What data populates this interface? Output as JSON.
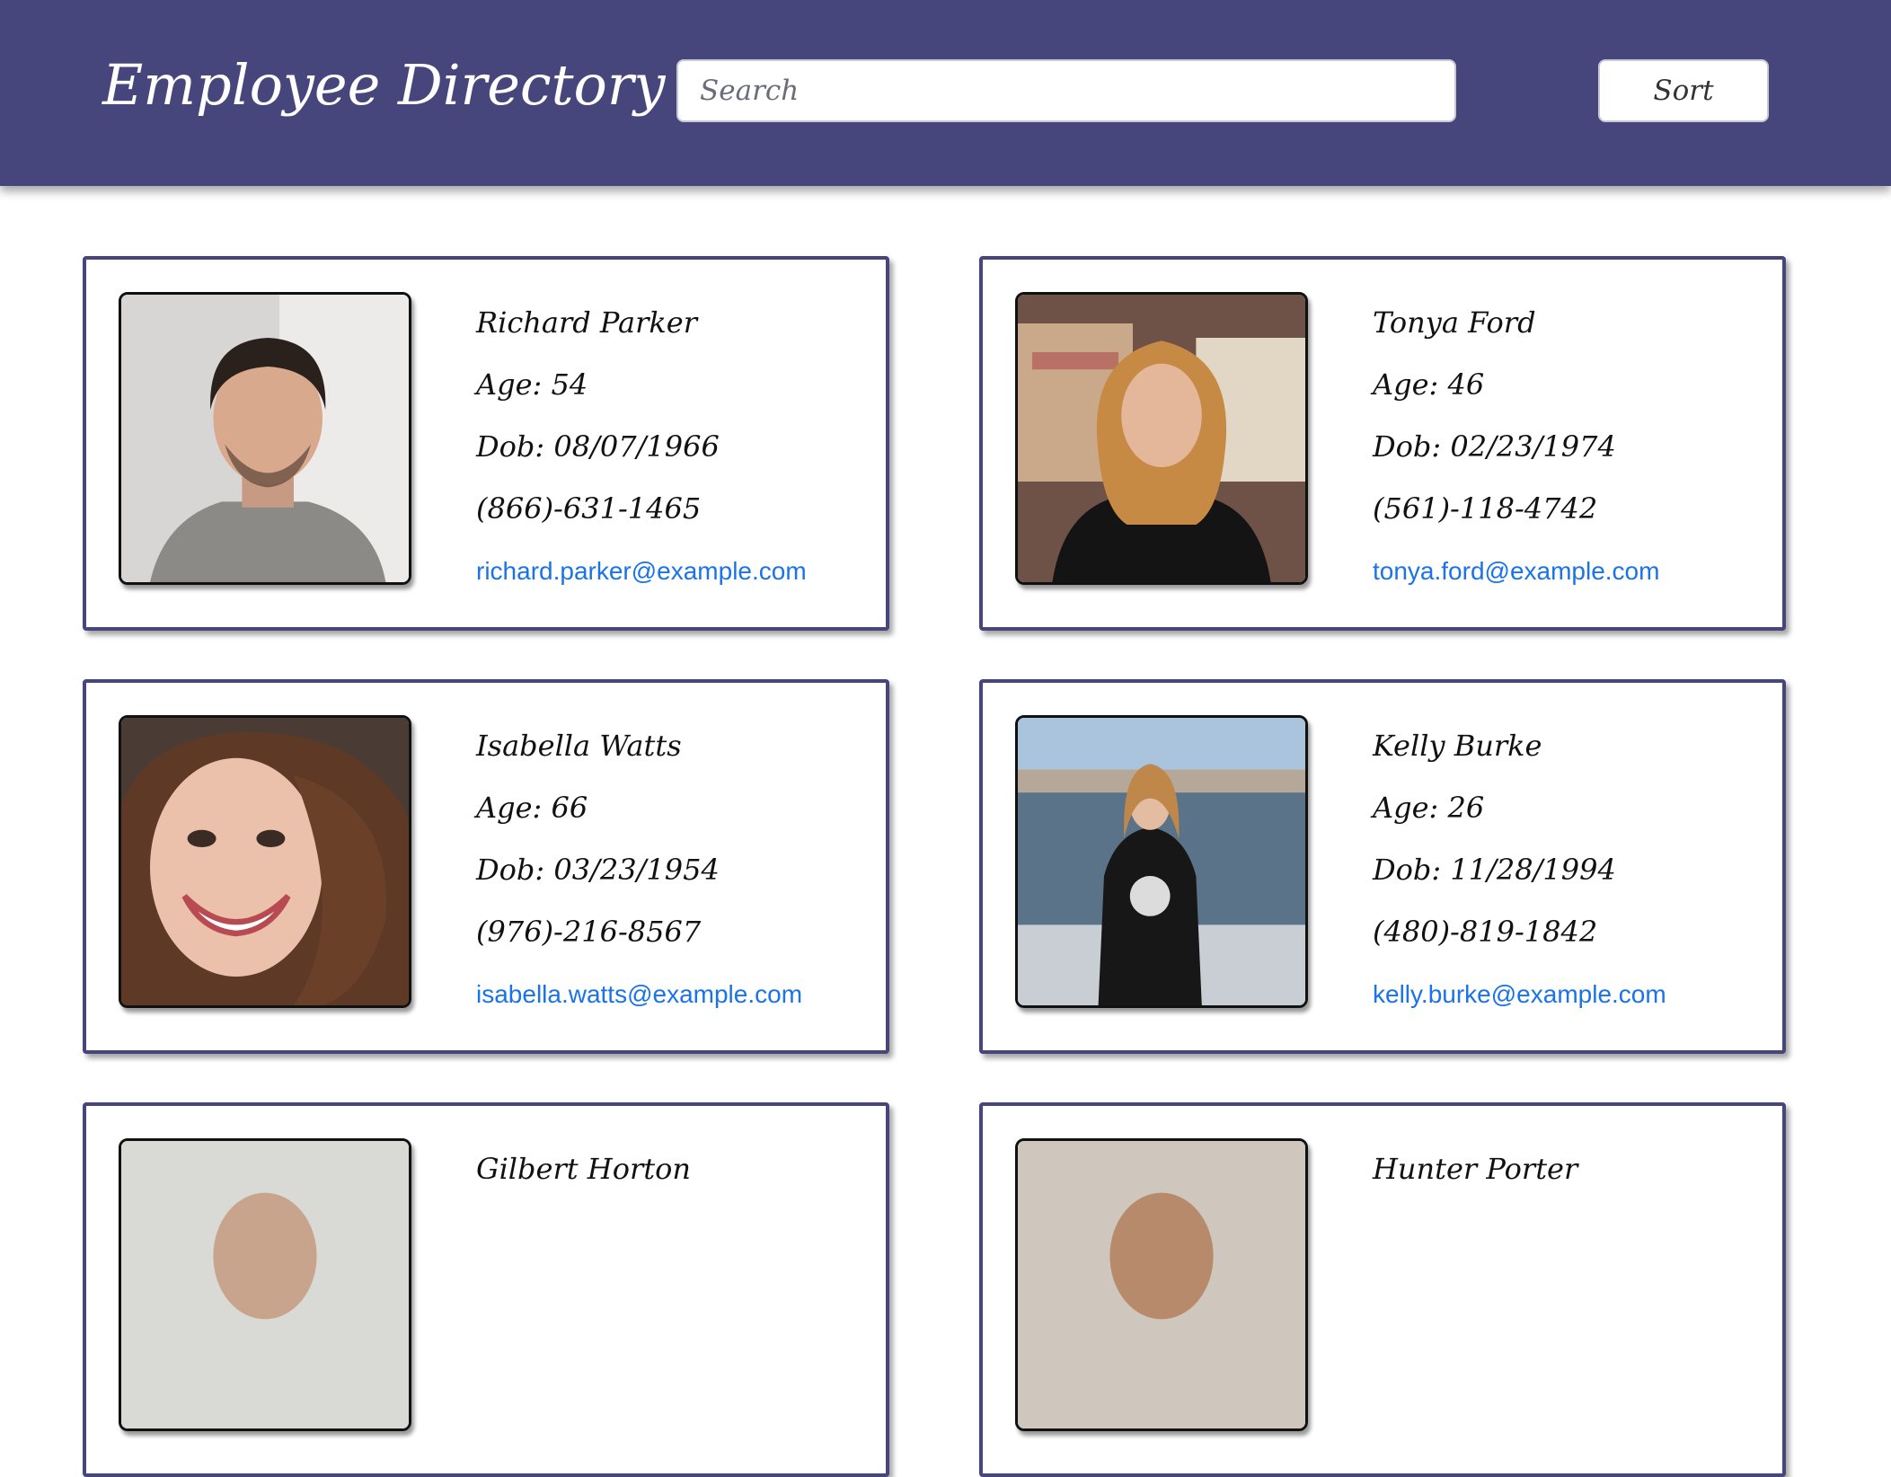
{
  "header": {
    "title": "Employee Directory",
    "search_placeholder": "Search",
    "sort_label": "Sort"
  },
  "colors": {
    "header_bg": "#47467c",
    "card_border": "#47467c",
    "email_link": "#1a73e8"
  },
  "employees": [
    {
      "name": "Richard Parker",
      "age": "Age: 54",
      "dob": "Dob:  08/07/1966",
      "phone": "(866)-631-1465",
      "email": "richard.parker@example.com"
    },
    {
      "name": "Tonya Ford",
      "age": "Age: 46",
      "dob": "Dob:  02/23/1974",
      "phone": "(561)-118-4742",
      "email": "tonya.ford@example.com"
    },
    {
      "name": "Isabella Watts",
      "age": "Age: 66",
      "dob": "Dob:  03/23/1954",
      "phone": "(976)-216-8567",
      "email": "isabella.watts@example.com"
    },
    {
      "name": "Kelly Burke",
      "age": "Age: 26",
      "dob": "Dob:  11/28/1994",
      "phone": "(480)-819-1842",
      "email": "kelly.burke@example.com"
    },
    {
      "name": "Gilbert Horton",
      "age": "",
      "dob": "",
      "phone": "",
      "email": ""
    },
    {
      "name": "Hunter Porter",
      "age": "",
      "dob": "",
      "phone": "",
      "email": ""
    }
  ]
}
